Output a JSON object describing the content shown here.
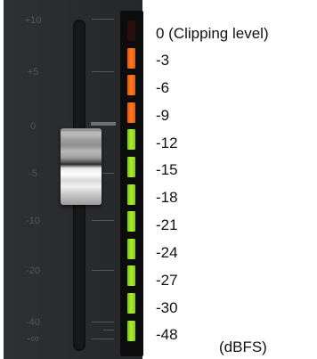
{
  "fader_scale": [
    "+10",
    "+5",
    "0",
    "-5",
    "-10",
    "-20",
    "-40",
    "-∞"
  ],
  "meter_labels": [
    "0 (Clipping level)",
    "-3",
    "-6",
    "-9",
    "-12",
    "-15",
    "-18",
    "-21",
    "-24",
    "-27",
    "-30",
    "-48"
  ],
  "unit_label": "(dBFS)",
  "meter_segments": [
    "off",
    "orange",
    "orange",
    "orange",
    "green",
    "green",
    "green",
    "green",
    "green",
    "green",
    "green",
    "green"
  ],
  "colors": {
    "panel": "#2c2d30",
    "clip_off": "#2a0d0d",
    "orange": "#ff7a1a",
    "green": "#a9ee2a"
  }
}
